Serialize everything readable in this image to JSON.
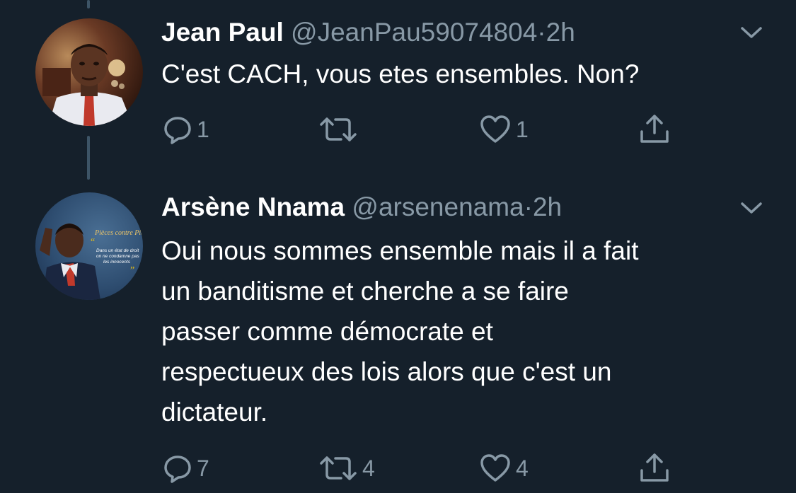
{
  "tweets": [
    {
      "author_name": "Jean Paul",
      "handle": "@JeanPau59074804",
      "separator": "·",
      "time": "2h",
      "text": "C'est CACH, vous etes ensembles. Non?",
      "actions": {
        "reply_icon": "reply-icon",
        "reply_count": "1",
        "retweet_icon": "retweet-icon",
        "retweet_count": "",
        "like_icon": "heart-icon",
        "like_count": "1",
        "share_icon": "share-icon"
      }
    },
    {
      "author_name": "Arsène Nnama",
      "handle": "@arsenenama",
      "separator": "·",
      "time": "2h",
      "text": "Oui nous sommes ensemble mais il a fait\nun banditisme et cherche a se faire\npasser comme démocrate et\nrespectueux des lois alors que c'est un\ndictateur.",
      "avatar_banner": {
        "title": "Pièces contre Pièces",
        "quote_open": "“",
        "line1": "Dans un état de droit",
        "line2": "on ne condamne pas",
        "line3": "les innocents",
        "quote_close": "”"
      },
      "actions": {
        "reply_icon": "reply-icon",
        "reply_count": "7",
        "retweet_icon": "retweet-icon",
        "retweet_count": "4",
        "like_icon": "heart-icon",
        "like_count": "4",
        "share_icon": "share-icon"
      }
    }
  ],
  "colors": {
    "background": "#15202b",
    "text_primary": "#ffffff",
    "text_secondary": "#8899a6",
    "thread_line": "#3d5466"
  }
}
